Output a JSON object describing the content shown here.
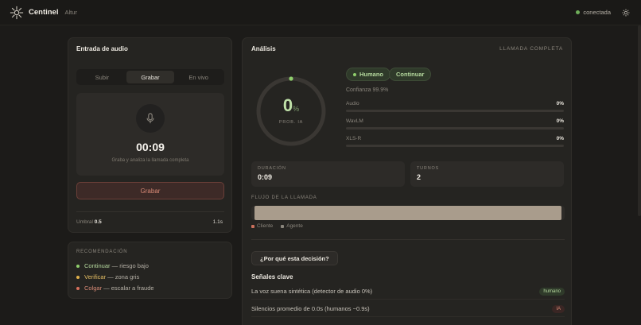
{
  "app": {
    "name": "Centinel",
    "subtitle": "Altur",
    "status": "conectada"
  },
  "audio_input": {
    "title": "Entrada de audio",
    "tabs": [
      "Subir",
      "Grabar",
      "En vivo"
    ],
    "active_tab": "Grabar",
    "timer": "00:09",
    "hint": "Graba y analiza la llamada completa",
    "record_button": "Grabar",
    "threshold_label": "Umbral",
    "threshold_value": "0.5",
    "duration_value": "1.1s"
  },
  "recommendation": {
    "title": "Recomendación",
    "items": [
      {
        "key": "Continuar",
        "desc": " — riesgo bajo",
        "color": "#8fcf6c"
      },
      {
        "key": "Verificar",
        "desc": " — zona gris",
        "color": "#e0b04a"
      },
      {
        "key": "Colgar",
        "desc": " — escalar a fraude",
        "color": "#d8705c"
      }
    ]
  },
  "analysis": {
    "title": "Análisis",
    "mode": "LLAMADA COMPLETA",
    "gauge": {
      "value": "0",
      "unit": "%",
      "label": "PROB. IA",
      "fraction": 0.0
    },
    "verdict": "Humano",
    "action": "Continuar",
    "confidence": "Confianza 99.9%",
    "metrics": [
      {
        "label": "Audio",
        "value": "0%",
        "fraction": 0.0
      },
      {
        "label": "WavLM",
        "value": "0%",
        "fraction": 0.0
      },
      {
        "label": "XLS-R",
        "value": "0%",
        "fraction": 0.0
      }
    ],
    "duration": {
      "label": "DURACIÓN",
      "value": "0:09"
    },
    "turns": {
      "label": "TURNOS",
      "value": "2"
    },
    "flow": {
      "title": "FLUJO DE LA LLAMADA",
      "legend": [
        "Cliente",
        "Agente"
      ],
      "colors": [
        "#c9705c",
        "#8a857c"
      ]
    },
    "why_button": "¿Por qué esta decisión?",
    "signals_title": "Señales clave",
    "signals": [
      {
        "text": "La voz suena sintética (detector de audio 0%)",
        "tag": "humano",
        "kind": "h"
      },
      {
        "text": "Silencios promedio de 0.0s (humanos ~0.9s)",
        "tag": "IA",
        "kind": "ia"
      }
    ]
  }
}
